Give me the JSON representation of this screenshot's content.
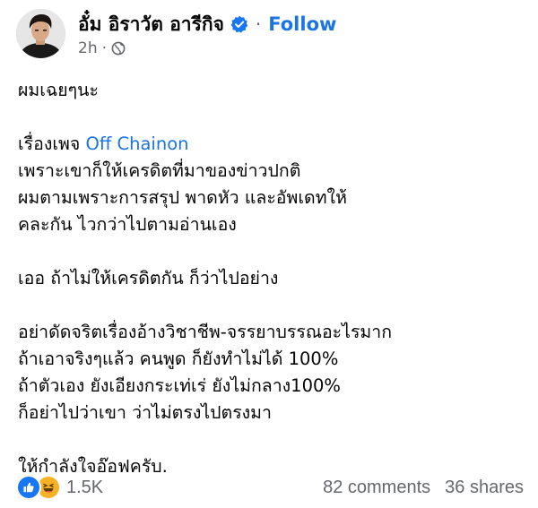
{
  "header": {
    "author_name": "อั๋ม อิราวัต อารีกิจ",
    "separator": "·",
    "follow_label": "Follow",
    "timestamp": "2h",
    "time_separator": "·",
    "privacy_icon": "globe-icon",
    "verified_icon": "verified-badge-icon"
  },
  "post": {
    "line1": "ผมเฉยๆนะ",
    "line2_prefix": "เรื่องเพจ ",
    "line2_mention": "Off Chainon",
    "line3": "เพราะเขาก็ให้เครดิตที่มาของข่าวปกติ",
    "line4": "ผมตามเพราะการสรุป พาดหัว และอัพเดทให้",
    "line5": "คละกัน ไวกว่าไปตามอ่านเอง",
    "line6": "เออ ถ้าไม่ให้เครดิตกัน ก็ว่าไปอย่าง",
    "line7": "อย่าดัดจริตเรื่องอ้างวิชาชีพ-จรรยาบรรณอะไรมาก",
    "line8": "ถ้าเอาจริงๆแล้ว คนพูด ก็ยังทำไม่ได้ 100%",
    "line9": "ถ้าตัวเอง ยังเอียงกระเท่เร่ ยังไม่กลาง100%",
    "line10": "ก็อย่าไปว่าเขา ว่าไม่ตรงไปตรงมา",
    "line11": "ให้กำลังใจอ๊อฟครับ."
  },
  "footer": {
    "reaction_icons": [
      "like-icon",
      "haha-icon"
    ],
    "reaction_count": "1.5K",
    "comments": "82 comments",
    "shares": "36 shares"
  },
  "colors": {
    "link_blue": "#1b74e4",
    "secondary_gray": "#65676b",
    "like_blue": "#1877f2",
    "haha_yellow": "#f7b125"
  }
}
